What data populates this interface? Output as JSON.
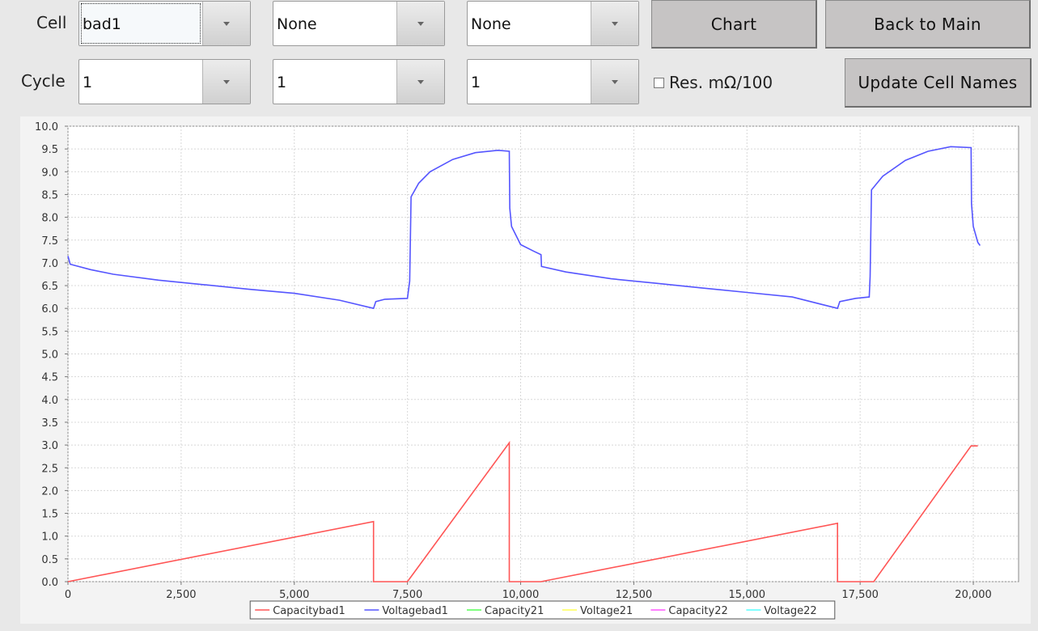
{
  "controls": {
    "cell_label": "Cell",
    "cycle_label": "Cycle",
    "cell_select_1": "bad1",
    "cell_select_2": "None",
    "cell_select_3": "None",
    "cycle_select_1": "1",
    "cycle_select_2": "1",
    "cycle_select_3": "1",
    "chart_button": "Chart",
    "back_button": "Back to Main",
    "update_button": "Update Cell Names",
    "resistance_checkbox_label": "Res. mΩ/100",
    "resistance_checked": false
  },
  "chart_data": {
    "type": "line",
    "title": "",
    "xlabel": "",
    "ylabel": "",
    "xlim": [
      0,
      21000
    ],
    "ylim": [
      0,
      10
    ],
    "x_ticks": [
      "0",
      "2,500",
      "5,000",
      "7,500",
      "10,000",
      "12,500",
      "15,000",
      "17,500",
      "20,000"
    ],
    "y_ticks": [
      "0.0",
      "0.5",
      "1.0",
      "1.5",
      "2.0",
      "2.5",
      "3.0",
      "3.5",
      "4.0",
      "4.5",
      "5.0",
      "5.5",
      "6.0",
      "6.5",
      "7.0",
      "7.5",
      "8.0",
      "8.5",
      "9.0",
      "9.5",
      "10.0"
    ],
    "grid": true,
    "legend_position": "bottom",
    "series": [
      {
        "name": "Capacitybad1",
        "color": "#ff5555",
        "points": [
          [
            0,
            0
          ],
          [
            6750,
            1.32
          ],
          [
            6750,
            0
          ],
          [
            7500,
            0
          ],
          [
            9750,
            3.05
          ],
          [
            9750,
            0
          ],
          [
            10450,
            0
          ],
          [
            17000,
            1.28
          ],
          [
            17000,
            0
          ],
          [
            17800,
            0
          ],
          [
            19950,
            2.98
          ],
          [
            20100,
            2.98
          ]
        ]
      },
      {
        "name": "Voltagebad1",
        "color": "#5555ff",
        "points": [
          [
            0,
            7.15
          ],
          [
            50,
            6.97
          ],
          [
            500,
            6.85
          ],
          [
            1000,
            6.75
          ],
          [
            2000,
            6.62
          ],
          [
            3000,
            6.52
          ],
          [
            4000,
            6.42
          ],
          [
            5000,
            6.33
          ],
          [
            6000,
            6.18
          ],
          [
            6750,
            6.0
          ],
          [
            6800,
            6.15
          ],
          [
            7000,
            6.2
          ],
          [
            7500,
            6.22
          ],
          [
            7550,
            6.6
          ],
          [
            7580,
            8.45
          ],
          [
            7750,
            8.75
          ],
          [
            8000,
            9.0
          ],
          [
            8500,
            9.27
          ],
          [
            9000,
            9.42
          ],
          [
            9500,
            9.47
          ],
          [
            9750,
            9.45
          ],
          [
            9760,
            8.2
          ],
          [
            9800,
            7.8
          ],
          [
            10000,
            7.4
          ],
          [
            10300,
            7.25
          ],
          [
            10450,
            7.18
          ],
          [
            10460,
            6.92
          ],
          [
            11000,
            6.8
          ],
          [
            12000,
            6.65
          ],
          [
            13000,
            6.55
          ],
          [
            14000,
            6.45
          ],
          [
            15000,
            6.35
          ],
          [
            16000,
            6.25
          ],
          [
            17000,
            6.0
          ],
          [
            17050,
            6.15
          ],
          [
            17400,
            6.22
          ],
          [
            17700,
            6.25
          ],
          [
            17720,
            6.7
          ],
          [
            17750,
            8.6
          ],
          [
            18000,
            8.9
          ],
          [
            18500,
            9.25
          ],
          [
            19000,
            9.45
          ],
          [
            19500,
            9.55
          ],
          [
            19950,
            9.53
          ],
          [
            19960,
            8.3
          ],
          [
            20000,
            7.8
          ],
          [
            20100,
            7.45
          ],
          [
            20150,
            7.38
          ]
        ]
      },
      {
        "name": "Capacity21",
        "color": "#55ff55",
        "points": []
      },
      {
        "name": "Voltage21",
        "color": "#ffff55",
        "points": []
      },
      {
        "name": "Capacity22",
        "color": "#ff55ff",
        "points": []
      },
      {
        "name": "Voltage22",
        "color": "#55ffff",
        "points": []
      }
    ]
  }
}
